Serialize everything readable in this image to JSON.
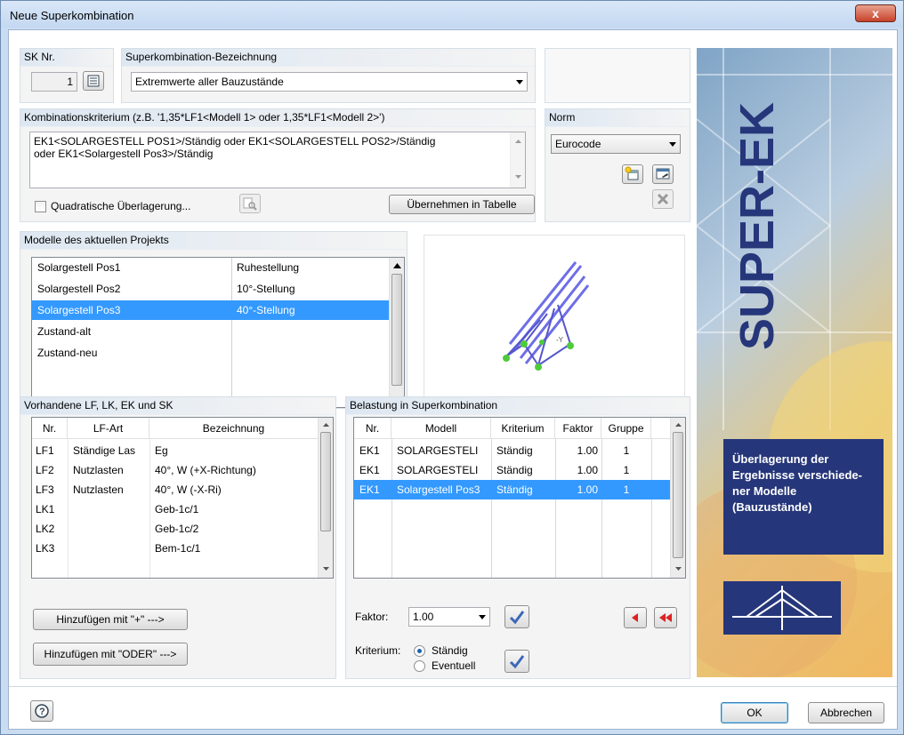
{
  "window": {
    "title": "Neue Superkombination",
    "close_label": "x"
  },
  "sk": {
    "label": "SK Nr.",
    "value": "1"
  },
  "bezeichnung": {
    "label": "Superkombination-Bezeichnung",
    "value": "Extremwerte aller Bauzustände"
  },
  "kriterium": {
    "label": "Kombinationskriterium (z.B. '1,35*LF1<Modell 1> oder 1,35*LF1<Modell 2>')",
    "text_line1": "EK1<SOLARGESTELL POS1>/Ständig oder EK1<SOLARGESTELL POS2>/Ständig",
    "text_line2": "oder EK1<Solargestell Pos3>/Ständig",
    "quadratic_label": "Quadratische Überlagerung...",
    "apply_button": "Übernehmen in Tabelle"
  },
  "norm": {
    "label": "Norm",
    "value": "Eurocode"
  },
  "modelle": {
    "label": "Modelle des aktuellen Projekts",
    "rows": [
      {
        "name": "Solargestell Pos1",
        "desc": "Ruhestellung"
      },
      {
        "name": "Solargestell Pos2",
        "desc": "10°-Stellung"
      },
      {
        "name": "Solargestell Pos3",
        "desc": "40°-Stellung"
      },
      {
        "name": "Zustand-alt",
        "desc": ""
      },
      {
        "name": "Zustand-neu",
        "desc": ""
      }
    ],
    "selected_index": 2
  },
  "vorhandene": {
    "label": "Vorhandene LF, LK, EK und SK",
    "columns": [
      "Nr.",
      "LF-Art",
      "Bezeichnung"
    ],
    "rows": [
      {
        "nr": "LF1",
        "art": "Ständige Las",
        "bez": "Eg"
      },
      {
        "nr": "LF2",
        "art": "Nutzlasten",
        "bez": "40°, W (+X-Richtung)"
      },
      {
        "nr": "LF3",
        "art": "Nutzlasten",
        "bez": "40°, W (-X-Ri)"
      },
      {
        "nr": "LK1",
        "art": "",
        "bez": "Geb-1c/1"
      },
      {
        "nr": "LK2",
        "art": "",
        "bez": "Geb-1c/2"
      },
      {
        "nr": "LK3",
        "art": "",
        "bez": "Bem-1c/1"
      }
    ],
    "add_plus": "Hinzufügen mit \"+\" --->",
    "add_oder": "Hinzufügen mit \"ODER\" --->"
  },
  "belastung": {
    "label": "Belastung in Superkombination",
    "columns": [
      "Nr.",
      "Modell",
      "Kriterium",
      "Faktor",
      "Gruppe"
    ],
    "rows": [
      {
        "nr": "EK1",
        "modell": "SOLARGESTELI",
        "krit": "Ständig",
        "faktor": "1.00",
        "gruppe": "1"
      },
      {
        "nr": "EK1",
        "modell": "SOLARGESTELI",
        "krit": "Ständig",
        "faktor": "1.00",
        "gruppe": "1"
      },
      {
        "nr": "EK1",
        "modell": "Solargestell Pos3",
        "krit": "Ständig",
        "faktor": "1.00",
        "gruppe": "1"
      }
    ],
    "selected_index": 2,
    "faktor_label": "Faktor:",
    "faktor_value": "1.00",
    "kriterium_label": "Kriterium:",
    "opt_staendig": "Ständig",
    "opt_eventuell": "Eventuell"
  },
  "banner": {
    "title": "SUPER-EK",
    "line1": "Überlagerung der",
    "line2": "Ergebnisse verschiede-",
    "line3": "ner Modelle",
    "line4": "(Bauzustände)"
  },
  "footer": {
    "ok": "OK",
    "cancel": "Abbrechen"
  }
}
